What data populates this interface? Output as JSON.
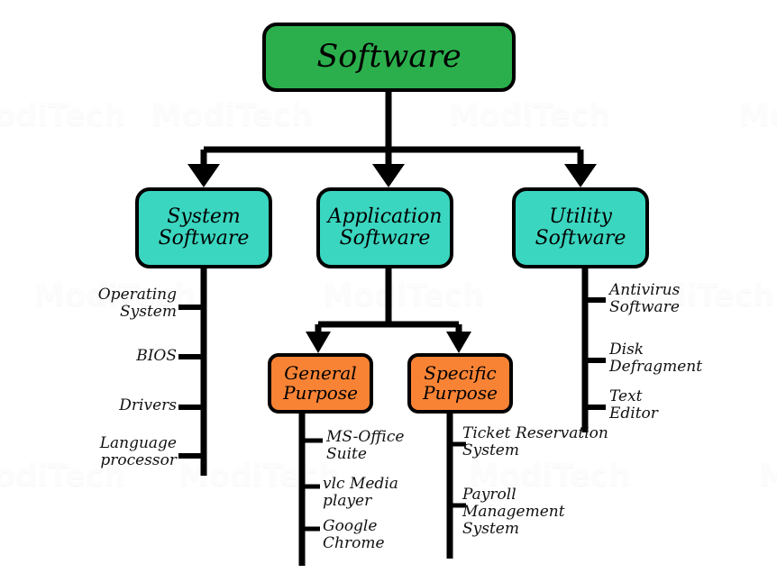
{
  "diagram": {
    "title": "Software classification tree",
    "watermark_text": "ModiTech",
    "colors": {
      "root_fill": "#2BAF4C",
      "level2_fill": "#3BD6C0",
      "level3_fill": "#F98335",
      "stroke": "#000000",
      "background": "#FFFFFF",
      "watermark": "#FCFCFC"
    },
    "root": {
      "label": "Software"
    },
    "branches": [
      {
        "id": "system-software",
        "label_line1": "System",
        "label_line2": "Software",
        "leaves": [
          {
            "line1": "Operating",
            "line2": "System"
          },
          {
            "line1": "BIOS",
            "line2": ""
          },
          {
            "line1": "Drivers",
            "line2": ""
          },
          {
            "line1": "Language",
            "line2": "processor"
          }
        ]
      },
      {
        "id": "application-software",
        "label_line1": "Application",
        "label_line2": "Software",
        "children": [
          {
            "id": "general-purpose",
            "label_line1": "General",
            "label_line2": "Purpose",
            "leaves": [
              {
                "line1": "MS-Office",
                "line2": "Suite"
              },
              {
                "line1": "vlc Media",
                "line2": "player"
              },
              {
                "line1": "Google",
                "line2": "Chrome"
              }
            ]
          },
          {
            "id": "specific-purpose",
            "label_line1": "Specific",
            "label_line2": "Purpose",
            "leaves": [
              {
                "line1": "Ticket Reservation",
                "line2": "System"
              },
              {
                "line1": "Payroll",
                "line2": "Management",
                "line3": "System"
              }
            ]
          }
        ]
      },
      {
        "id": "utility-software",
        "label_line1": "Utility",
        "label_line2": "Software",
        "leaves": [
          {
            "line1": "Antivirus",
            "line2": "Software"
          },
          {
            "line1": "Disk",
            "line2": "Defragment"
          },
          {
            "line1": "Text",
            "line2": "Editor"
          }
        ]
      }
    ]
  }
}
